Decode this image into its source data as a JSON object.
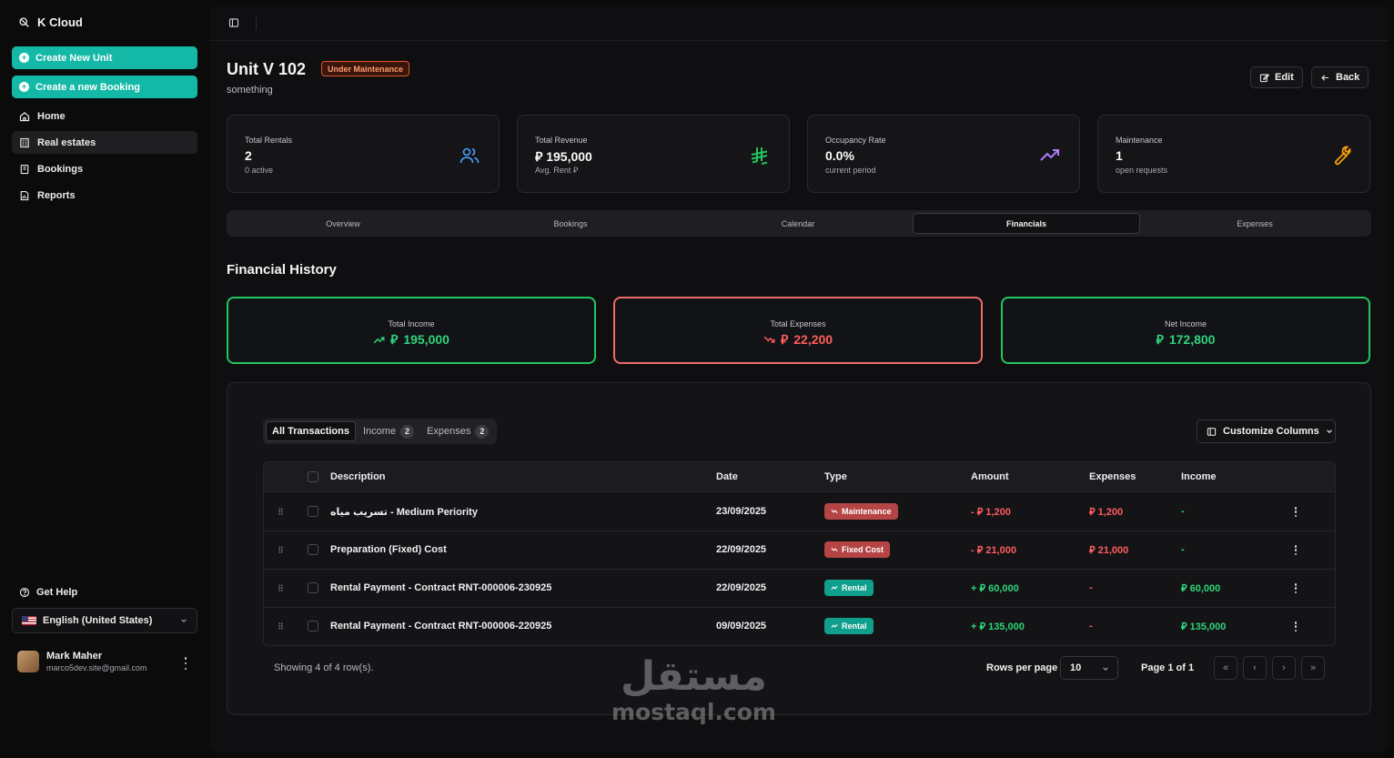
{
  "app": {
    "name": "K Cloud"
  },
  "sidebar": {
    "actions": [
      {
        "label": "Create New Unit"
      },
      {
        "label": "Create a new Booking"
      }
    ],
    "nav": [
      {
        "label": "Home"
      },
      {
        "label": "Real estates"
      },
      {
        "label": "Bookings"
      },
      {
        "label": "Reports"
      }
    ],
    "help": "Get Help",
    "language": "English (United States)",
    "user": {
      "name": "Mark Maher",
      "email": "marco5dev.site@gmail.com"
    }
  },
  "unit": {
    "title": "Unit V 102",
    "status": "Under Maintenance",
    "description": "something",
    "edit_label": "Edit",
    "back_label": "Back"
  },
  "stats": [
    {
      "label": "Total Rentals",
      "value": "2",
      "sub": "0 active",
      "icon": "users-icon"
    },
    {
      "label": "Total Revenue",
      "value": "195,000",
      "sub": "Avg. Rent",
      "icon": "currency-icon"
    },
    {
      "label": "Occupancy Rate",
      "value": "0.0%",
      "sub": "current period",
      "icon": "trending-up-icon"
    },
    {
      "label": "Maintenance",
      "value": "1",
      "sub": "open requests",
      "icon": "wrench-icon"
    }
  ],
  "tabs": [
    {
      "label": "Overview"
    },
    {
      "label": "Bookings"
    },
    {
      "label": "Calendar"
    },
    {
      "label": "Financials"
    },
    {
      "label": "Expenses"
    }
  ],
  "active_tab": "Financials",
  "financial": {
    "title": "Financial History",
    "summary": [
      {
        "label": "Total Income",
        "value": "195,000"
      },
      {
        "label": "Total Expenses",
        "value": "22,200"
      },
      {
        "label": "Net Income",
        "value": "172,800"
      }
    ]
  },
  "transactions": {
    "filters": [
      {
        "label": "All Transactions",
        "count": null
      },
      {
        "label": "Income",
        "count": "2"
      },
      {
        "label": "Expenses",
        "count": "2"
      }
    ],
    "customize_label": "Customize Columns",
    "columns": [
      "Description",
      "Date",
      "Type",
      "Amount",
      "Expenses",
      "Income"
    ],
    "rows": [
      {
        "description": "تسريب مياه - Medium Periority",
        "date": "23/09/2025",
        "type": "Maintenance",
        "amount": "- ⃁ 1,200",
        "expenses": "⃁ 1,200",
        "income": "-"
      },
      {
        "description": "Preparation (Fixed) Cost",
        "date": "22/09/2025",
        "type": "Fixed Cost",
        "amount": "- ⃁ 21,000",
        "expenses": "⃁ 21,000",
        "income": "-"
      },
      {
        "description": "Rental Payment - Contract RNT-000006-230925",
        "date": "22/09/2025",
        "type": "Rental",
        "amount": "+ ⃁ 60,000",
        "expenses": "-",
        "income": "⃁ 60,000"
      },
      {
        "description": "Rental Payment - Contract RNT-000006-220925",
        "date": "09/09/2025",
        "type": "Rental",
        "amount": "+ ⃁ 135,000",
        "expenses": "-",
        "income": "⃁ 135,000"
      }
    ],
    "showing": "Showing 4 of 4 row(s).",
    "rows_per_page_label": "Rows per page",
    "rows_per_page": "10",
    "page_info": "Page 1 of 1"
  },
  "watermark": {
    "arabic": "مستقل",
    "latin": "mostaql.com"
  },
  "colors": {
    "accent": "#14b8a6",
    "positive": "#22c55e",
    "negative": "#f26a6a",
    "maintenance_badge": "#b54545",
    "rental_badge": "#0f9f8c"
  }
}
